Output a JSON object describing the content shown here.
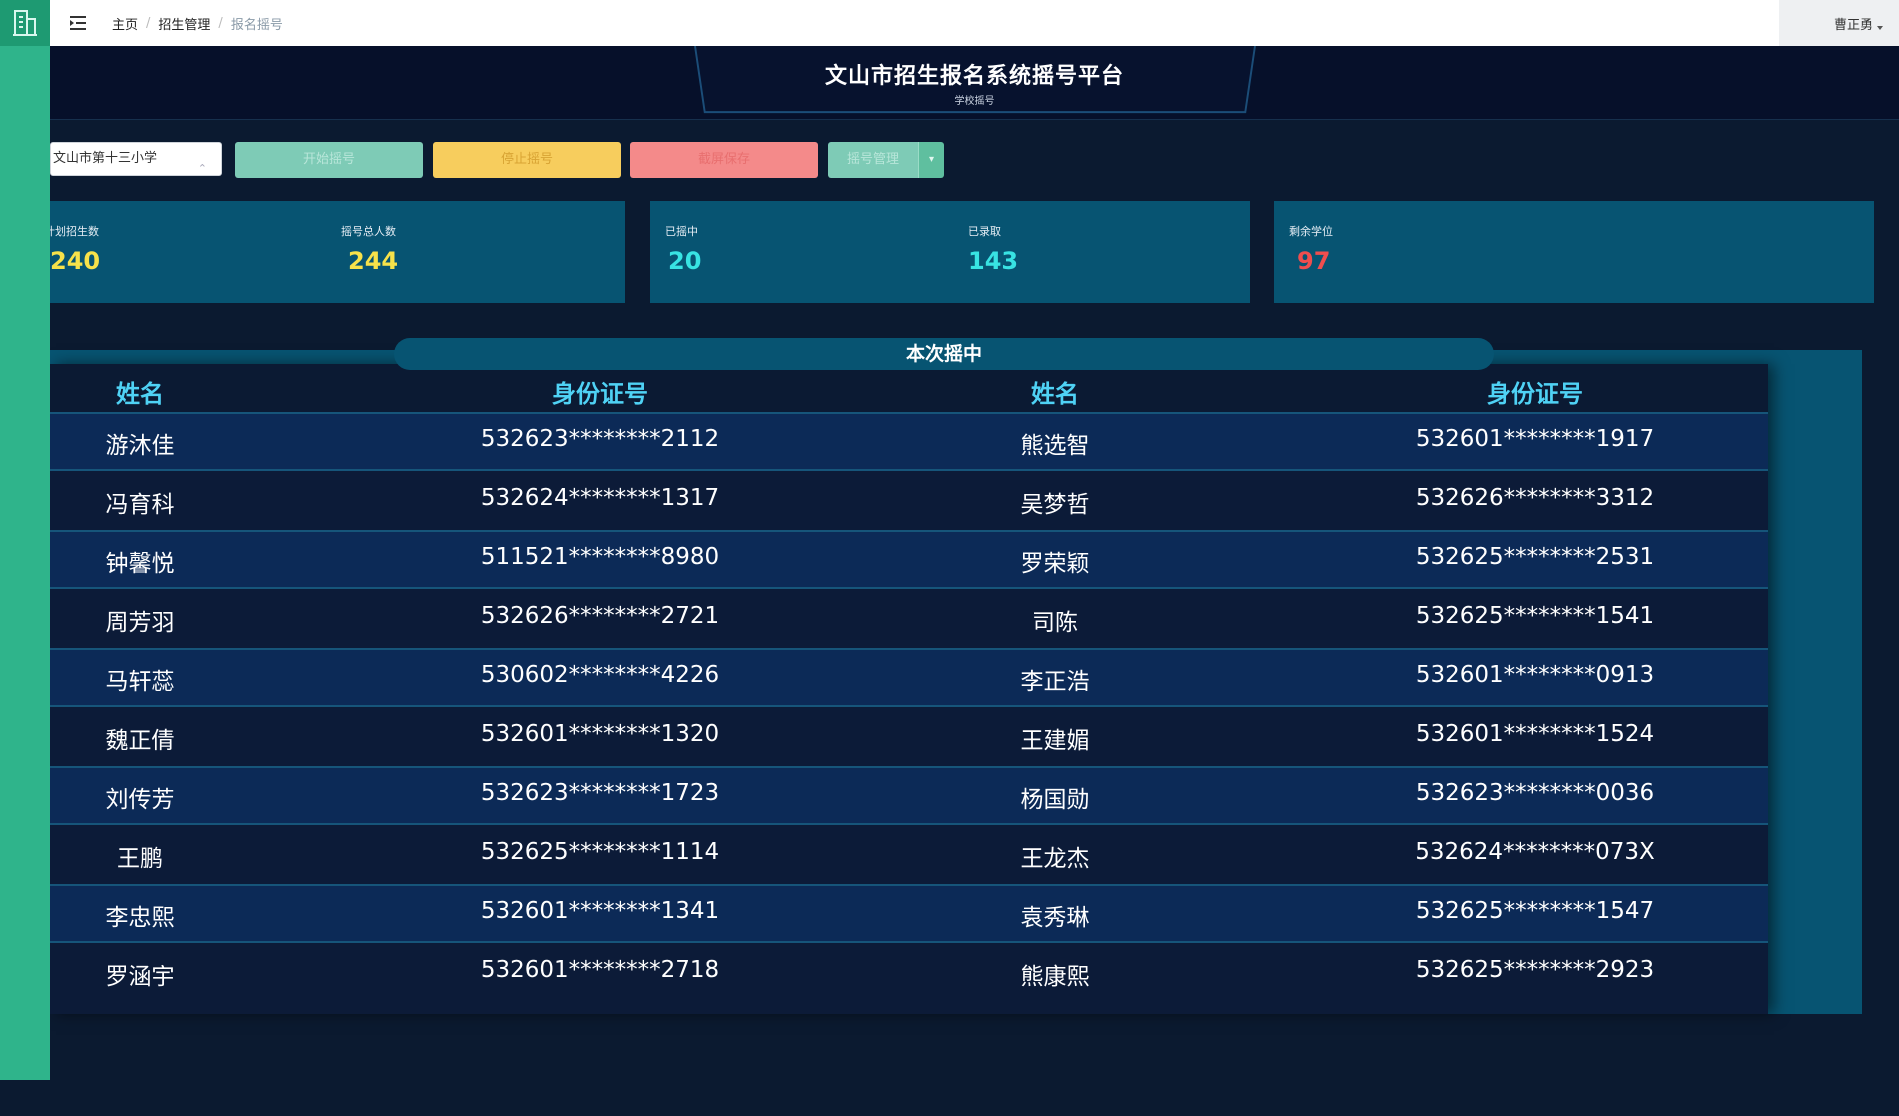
{
  "topbar": {
    "breadcrumb": [
      "主页",
      "招生管理",
      "报名摇号"
    ],
    "user_name": "曹正勇"
  },
  "header": {
    "title": "文山市招生报名系统摇号平台",
    "subtitle": "学校摇号"
  },
  "toolbar": {
    "school_select_value": "文山市第十三小学",
    "start_label": "开始摇号",
    "stop_label": "停止摇号",
    "save_label": "截屏保存",
    "manage_label": "摇号管理"
  },
  "stats": {
    "planned_label": "计划招生数",
    "planned_value": "240",
    "total_label": "摇号总人数",
    "total_value": "244",
    "drawn_label": "已摇中",
    "drawn_value": "20",
    "admitted_label": "已录取",
    "admitted_value": "143",
    "remaining_label": "剩余学位",
    "remaining_value": "97"
  },
  "result": {
    "title": "本次摇中",
    "headers": {
      "name1": "姓名",
      "id1": "身份证号",
      "name2": "姓名",
      "id2": "身份证号"
    },
    "rows": [
      {
        "name1": "游沐佳",
        "id1": "532623********2112",
        "name2": "熊选智",
        "id2": "532601********1917"
      },
      {
        "name1": "冯育科",
        "id1": "532624********1317",
        "name2": "吴梦哲",
        "id2": "532626********3312"
      },
      {
        "name1": "钟馨悦",
        "id1": "511521********8980",
        "name2": "罗荣颖",
        "id2": "532625********2531"
      },
      {
        "name1": "周芳羽",
        "id1": "532626********2721",
        "name2": "司陈",
        "id2": "532625********1541"
      },
      {
        "name1": "马轩蕊",
        "id1": "530602********4226",
        "name2": "李正浩",
        "id2": "532601********0913"
      },
      {
        "name1": "魏正倩",
        "id1": "532601********1320",
        "name2": "王建媚",
        "id2": "532601********1524"
      },
      {
        "name1": "刘传芳",
        "id1": "532623********1723",
        "name2": "杨国勋",
        "id2": "532623********0036"
      },
      {
        "name1": "王鹏",
        "id1": "532625********1114",
        "name2": "王龙杰",
        "id2": "532624********073X"
      },
      {
        "name1": "李忠熙",
        "id1": "532601********1341",
        "name2": "袁秀琳",
        "id2": "532625********1547"
      },
      {
        "name1": "罗涵宇",
        "id1": "532601********2718",
        "name2": "熊康熙",
        "id2": "532625********2923"
      }
    ]
  },
  "colors": {
    "sidebar": "#2fb48b",
    "background": "#0b1a30",
    "panel": "#075472",
    "header_text": "#4fd2f5",
    "stat_yellow": "#f7e24a",
    "stat_cyan": "#38e3e3",
    "stat_red": "#ef4e4e"
  }
}
